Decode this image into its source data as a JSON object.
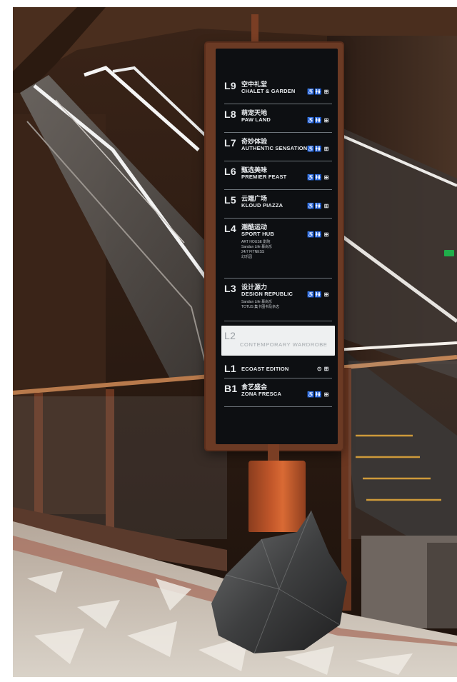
{
  "directory": {
    "floors": [
      {
        "code": "L9",
        "cn": "空中礼堂",
        "en": "CHALET & GARDEN",
        "amenities": "♿🚻 ⊞"
      },
      {
        "code": "L8",
        "cn": "萌宠天地",
        "en": "PAW LAND",
        "amenities": "♿🚻 ⊞"
      },
      {
        "code": "L7",
        "cn": "奇妙体验",
        "en": "AUTHENTIC SENSATIONS",
        "amenities": "♿🚻 ⊞"
      },
      {
        "code": "L6",
        "cn": "甄选美味",
        "en": "PREMIER FEAST",
        "amenities": "♿🚻 ⊞"
      },
      {
        "code": "L5",
        "cn": "云端广场",
        "en": "KLOUD PIAZZA",
        "amenities": "♿🚻 ⊞"
      },
      {
        "code": "L4",
        "cn": "潮酷运动",
        "en": "SPORT HUB",
        "amenities": "♿🚻 ⊞",
        "notes": [
          "ART HOUSE 影院",
          "Sandan Life 慕尚乐",
          "24/7 FITNESS",
          "幻乐园"
        ]
      },
      {
        "code": "L3",
        "cn": "设计源力",
        "en": "DESIGN REPUBLIC",
        "amenities": "♿🚻 ⊞",
        "notes": [
          "Sandan Life 慕尚乐",
          "TOTUS 集卡图书及杂志"
        ]
      },
      {
        "code": "L2",
        "cn": "",
        "en": "CONTEMPORARY WARDROBE",
        "amenities": ""
      },
      {
        "code": "L1",
        "cn": "",
        "en": "ECOAST EDITION",
        "amenities": "⊙ ⊞"
      },
      {
        "code": "B1",
        "cn": "食艺盛会",
        "en": "ZONA FRESCA",
        "amenities": "♿🚻 ⊞"
      }
    ]
  },
  "colors": {
    "sign_frame": "#6b3a24",
    "sign_screen": "#0d0f12",
    "highlight_row": "#eef0f1",
    "cylinder": "#c2572a",
    "exit_sign": "#1fae4a"
  }
}
